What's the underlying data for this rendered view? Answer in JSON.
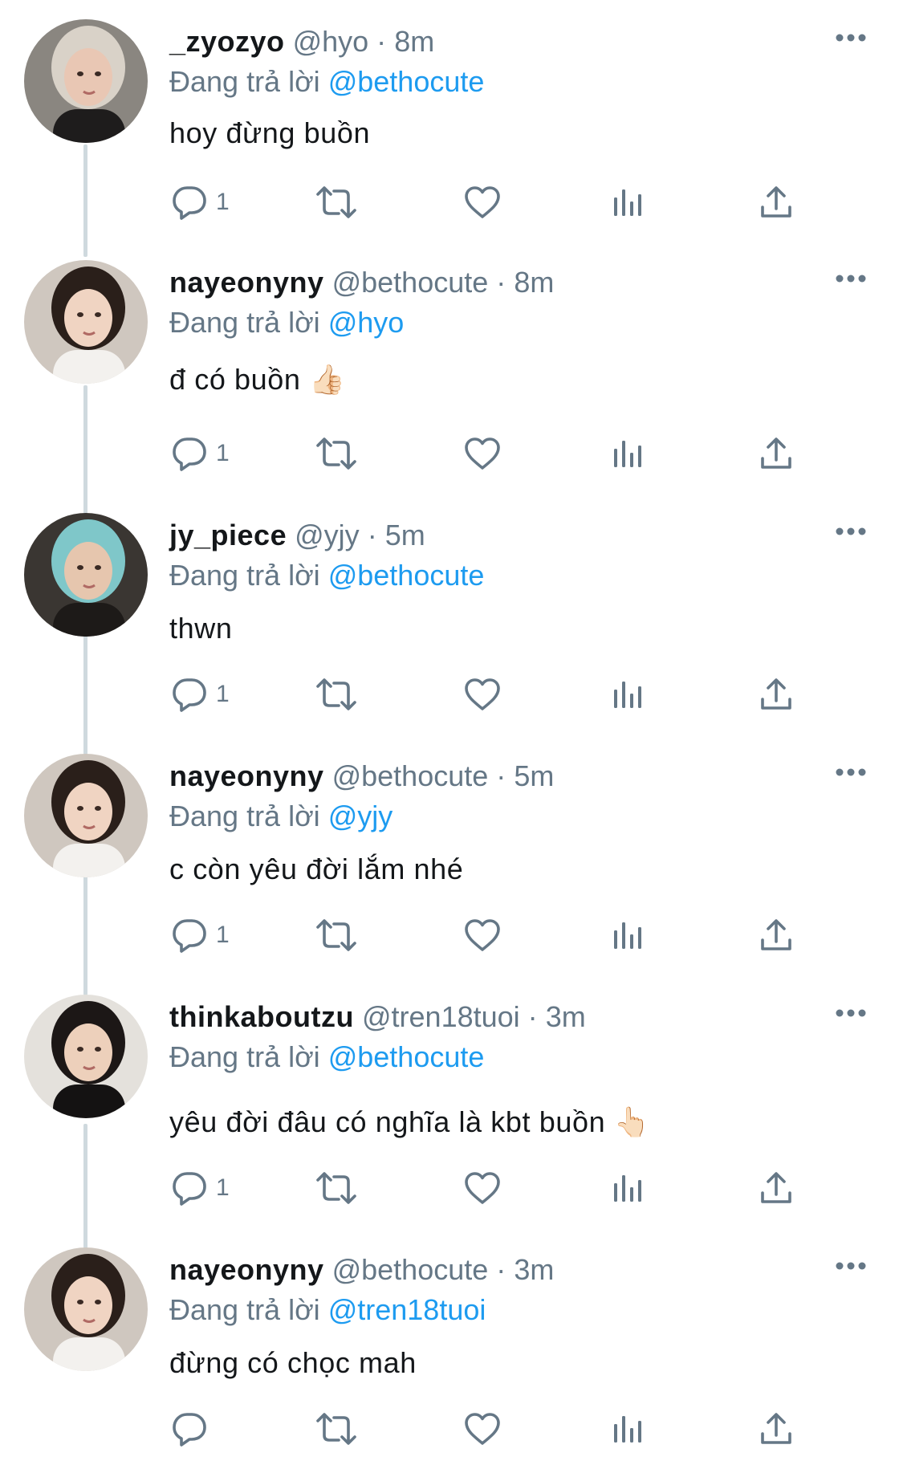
{
  "reply_prefix": "Đang trả lời",
  "tweets": [
    {
      "name": "_zyozyo",
      "handle": "@hyo",
      "separator": "·",
      "time": "8m",
      "reply_to": "@bethocute",
      "text": "hoy đừng buồn",
      "reply_count": "1"
    },
    {
      "name": "nayeonyny",
      "handle": "@bethocute",
      "separator": "·",
      "time": "8m",
      "reply_to": "@hyo",
      "text": "đ có buồn 👍🏻",
      "reply_count": "1"
    },
    {
      "name": "jy_piece",
      "handle": "@yjy",
      "separator": "·",
      "time": "5m",
      "reply_to": "@bethocute",
      "text": "thwn",
      "reply_count": "1"
    },
    {
      "name": "nayeonyny",
      "handle": "@bethocute",
      "separator": "·",
      "time": "5m",
      "reply_to": "@yjy",
      "text": "c còn yêu đời lắm nhé",
      "reply_count": "1"
    },
    {
      "name": "thinkaboutzu",
      "handle": "@tren18tuoi",
      "separator": "·",
      "time": "3m",
      "reply_to": "@bethocute",
      "text": "yêu đời đâu có nghĩa là kbt buồn 👆🏻",
      "reply_count": "1"
    },
    {
      "name": "nayeonyny",
      "handle": "@bethocute",
      "separator": "·",
      "time": "3m",
      "reply_to": "@tren18tuoi",
      "text": "đừng có chọc mah",
      "reply_count": ""
    }
  ],
  "colors": {
    "name": "#14171a",
    "secondary": "#657786",
    "mention": "#1d9bf0",
    "thread_line": "#cfd9de"
  },
  "icons": {
    "more": "more-horizontal-icon",
    "reply": "reply-bubble-icon",
    "retweet": "retweet-icon",
    "like": "heart-icon",
    "views": "analytics-bars-icon",
    "share": "share-upload-icon"
  }
}
